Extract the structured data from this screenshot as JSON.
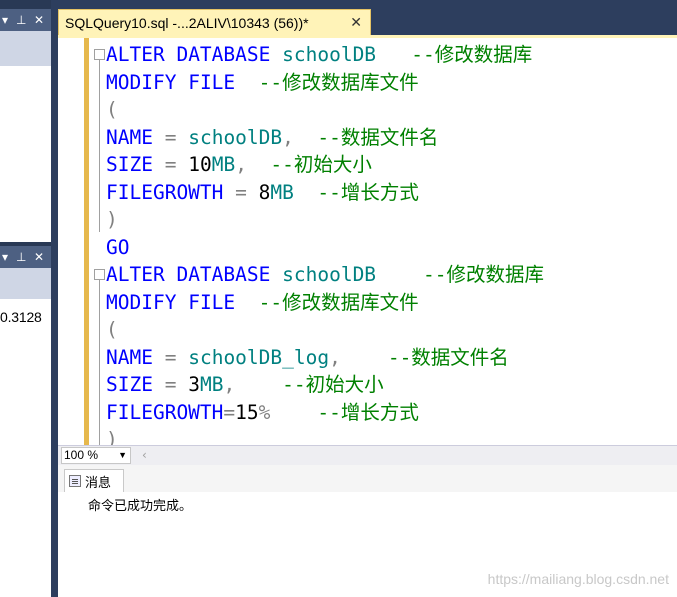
{
  "left_panels": {
    "top_panel": {
      "pin_icon_char": "▾",
      "pin_char": "⊥",
      "close_char": "✕"
    },
    "bottom_panel": {
      "value_text": "0.3128"
    }
  },
  "tab": {
    "title": "SQLQuery10.sql -...2ALIV\\10343 (56))*",
    "close_char": "✕"
  },
  "editor": {
    "lines": [
      [
        "ALTER DATABASE schoolDB   --修改数据库"
      ],
      [
        "MODIFY FILE  --修改数据库文件"
      ],
      [
        "("
      ],
      [
        "NAME = schoolDB,  --数据文件名"
      ],
      [
        "SIZE = 10MB,  --初始大小"
      ],
      [
        "FILEGROWTH = 8MB  --增长方式"
      ],
      [
        ")"
      ],
      [
        "GO"
      ],
      [
        "ALTER DATABASE schoolDB    --修改数据库"
      ],
      [
        "MODIFY FILE  --修改数据库文件"
      ],
      [
        "("
      ],
      [
        "NAME = schoolDB_log,    --数据文件名"
      ],
      [
        "SIZE = 3MB,    --初始大小"
      ],
      [
        "FILEGROWTH=15%    --增长方式"
      ],
      [
        ")"
      ]
    ]
  },
  "zoom": {
    "value": "100 %"
  },
  "results": {
    "tab_label": "消息",
    "message": "命令已成功完成。"
  },
  "watermark": "https://mailiang.blog.csdn.net",
  "colors": {
    "keyword": "#0000ff",
    "comment": "#008000",
    "identifier": "#008080",
    "operator": "#808080",
    "margin": "#e6b84c",
    "tab": "#fff3b8"
  }
}
